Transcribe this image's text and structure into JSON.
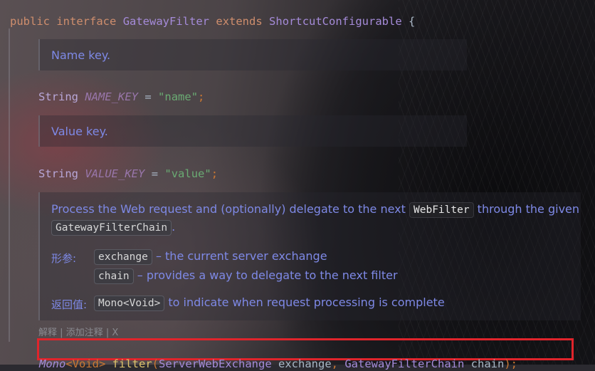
{
  "header": {
    "kw_public": "public",
    "kw_interface": "interface",
    "name": "GatewayFilter",
    "kw_extends": "extends",
    "parent": "ShortcutConfigurable",
    "brace": "{"
  },
  "field1": {
    "doc": "Name key.",
    "type": "String",
    "name": "NAME_KEY",
    "eq": "=",
    "value": "\"name\"",
    "semi": ";"
  },
  "field2": {
    "doc": "Value key.",
    "type": "String",
    "name": "VALUE_KEY",
    "eq": "=",
    "value": "\"value\"",
    "semi": ";"
  },
  "method_doc": {
    "desc_part1": "Process the Web request and (optionally) delegate to the next",
    "desc_code1": "WebFilter",
    "desc_part2": "through the given",
    "desc_code2": "GatewayFilterChain",
    "desc_end": ".",
    "params_label": "形参:",
    "param1_name": "exchange",
    "param1_desc": "– the current server exchange",
    "param2_name": "chain",
    "param2_desc": "– provides a way to delegate to the next filter",
    "return_label": "返回值:",
    "return_code": "Mono<Void>",
    "return_desc": "to indicate when request processing is complete"
  },
  "hint": {
    "explain": "解释",
    "sep1": "|",
    "add_comment": "添加注释",
    "sep2": "|",
    "close": "X"
  },
  "signature": {
    "ret_type": "Mono",
    "ret_generic": "<Void>",
    "method": "filter",
    "open": "(",
    "p1_type": "ServerWebExchange",
    "p1_name": "exchange",
    "comma": ",",
    "p2_type": "GatewayFilterChain",
    "p2_name": "chain",
    "close": ");"
  },
  "colors": {
    "highlight_box": "#e0242b",
    "doc_text": "#7e89e6",
    "keyword": "#cf8e6d",
    "string": "#6aab73"
  }
}
